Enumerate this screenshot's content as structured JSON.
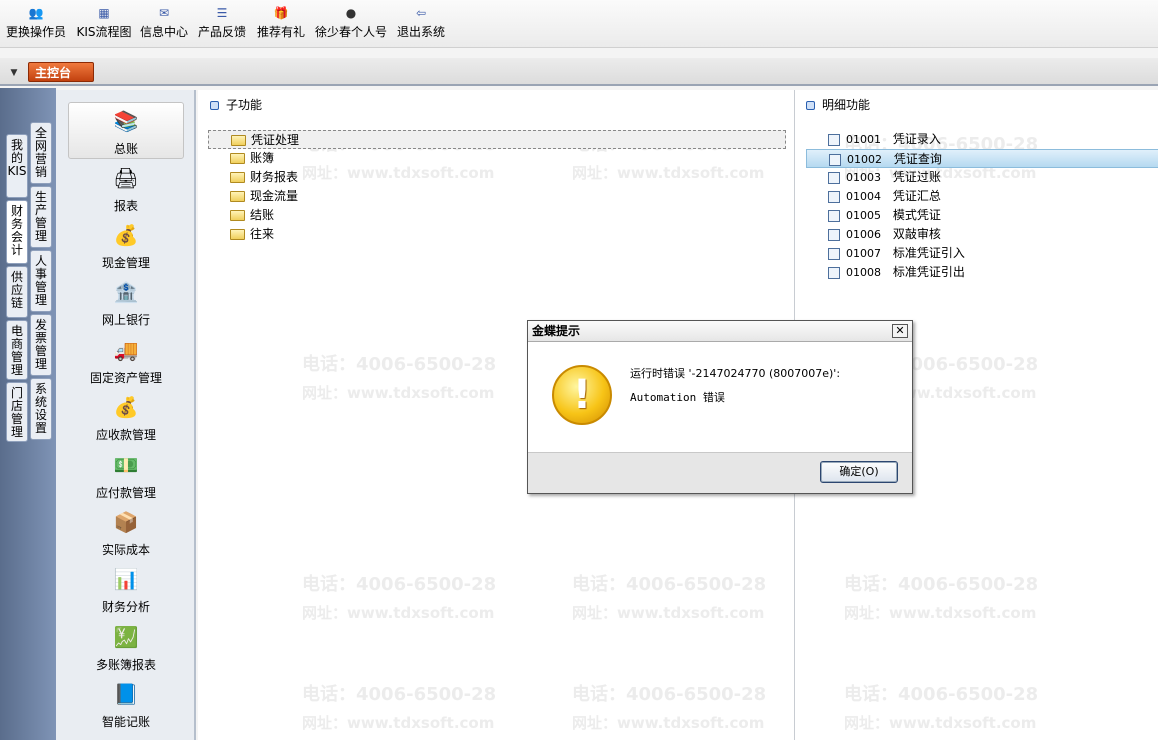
{
  "toolbar": {
    "items": [
      {
        "label": "更换操作员",
        "icon": "change-user-icon"
      },
      {
        "label": "KIS流程图",
        "icon": "flowchart-icon"
      },
      {
        "label": "信息中心",
        "icon": "message-icon"
      },
      {
        "label": "产品反馈",
        "icon": "feedback-icon"
      },
      {
        "label": "推荐有礼",
        "icon": "gift-icon"
      },
      {
        "label": "徐少春个人号",
        "icon": "person-icon"
      },
      {
        "label": "退出系统",
        "icon": "exit-icon"
      }
    ]
  },
  "tabs": {
    "main": "主控台"
  },
  "vertical_tabs": {
    "left": [
      "我的KIS",
      "财务会计",
      "供应链",
      "电商管理",
      "门店管理"
    ],
    "right": [
      "全网营销",
      "生产管理",
      "人事管理",
      "发票管理",
      "系统设置"
    ]
  },
  "modules": [
    {
      "label": "总账",
      "icon": "ledger-books-icon"
    },
    {
      "label": "报表",
      "icon": "report-icon"
    },
    {
      "label": "现金管理",
      "icon": "cash-icon"
    },
    {
      "label": "网上银行",
      "icon": "bank-icon"
    },
    {
      "label": "固定资产管理",
      "icon": "truck-icon"
    },
    {
      "label": "应收款管理",
      "icon": "money-bag-icon"
    },
    {
      "label": "应付款管理",
      "icon": "money-out-icon"
    },
    {
      "label": "实际成本",
      "icon": "cost-icon"
    },
    {
      "label": "财务分析",
      "icon": "analysis-icon"
    },
    {
      "label": "多账簿报表",
      "icon": "multi-ledger-icon"
    },
    {
      "label": "智能记账",
      "icon": "smart-book-icon"
    }
  ],
  "sub_functions": {
    "header": "子功能",
    "items": [
      "凭证处理",
      "账簿",
      "财务报表",
      "现金流量",
      "结账",
      "往来"
    ]
  },
  "detail_functions": {
    "header": "明细功能",
    "items": [
      {
        "code": "01001",
        "name": "凭证录入"
      },
      {
        "code": "01002",
        "name": "凭证查询"
      },
      {
        "code": "01003",
        "name": "凭证过账"
      },
      {
        "code": "01004",
        "name": "凭证汇总"
      },
      {
        "code": "01005",
        "name": "模式凭证"
      },
      {
        "code": "01006",
        "name": "双敲审核"
      },
      {
        "code": "01007",
        "name": "标准凭证引入"
      },
      {
        "code": "01008",
        "name": "标准凭证引出"
      }
    ]
  },
  "watermark": {
    "phone": "电话：4006-6500-28",
    "site": "网址：www.tdxsoft.com"
  },
  "dialog": {
    "title": "金蝶提示",
    "message_line1": "运行时错误 '-2147024770 (8007007e)':",
    "message_line2": "Automation 错误",
    "ok_label": "确定(O)",
    "close_glyph": "✕"
  }
}
